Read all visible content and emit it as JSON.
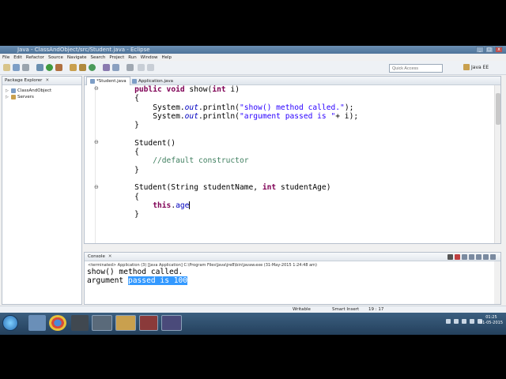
{
  "window": {
    "title": "Java - ClassAndObject/src/Student.java - Eclipse"
  },
  "menu": [
    "File",
    "Edit",
    "Refactor",
    "Source",
    "Navigate",
    "Search",
    "Project",
    "Run",
    "Window",
    "Help"
  ],
  "toolbar": {
    "quick_access_placeholder": "Quick Access",
    "perspective": "Java EE"
  },
  "package_explorer": {
    "title": "Package Explorer",
    "nodes": [
      "ClassAndObject",
      "Servers"
    ]
  },
  "editor": {
    "tabs": [
      "*Student.java",
      "Application.java"
    ],
    "lines": [
      [
        "    public void show(int i)"
      ],
      [
        "    {"
      ],
      [
        "        System.out.println(\"show() method called.\");"
      ],
      [
        "        System.out.println(\"argument passed is \"+ i);"
      ],
      [
        "    }"
      ],
      [
        ""
      ],
      [
        "    Student()"
      ],
      [
        "    {"
      ],
      [
        "        //default constructor"
      ],
      [
        "    }"
      ],
      [
        ""
      ],
      [
        "    Student(String studentName, int studentAge)"
      ],
      [
        "    {"
      ],
      [
        "        this.age"
      ],
      [
        "    }"
      ]
    ]
  },
  "console": {
    "title": "Console",
    "terminated": "<terminated> Application (3) [Java Application] C:\\Program Files\\Java\\jre8\\bin\\javaw.exe (31-May-2015 1:24:48 am)",
    "line1": "show() method called.",
    "line2_prefix": "argument ",
    "line2_selected": "passed is 100"
  },
  "status": {
    "writable": "Writable",
    "insert_mode": "Smart Insert",
    "position": "19 : 17"
  },
  "taskbar": {
    "time": "01:25",
    "date": "31-05-2015"
  }
}
